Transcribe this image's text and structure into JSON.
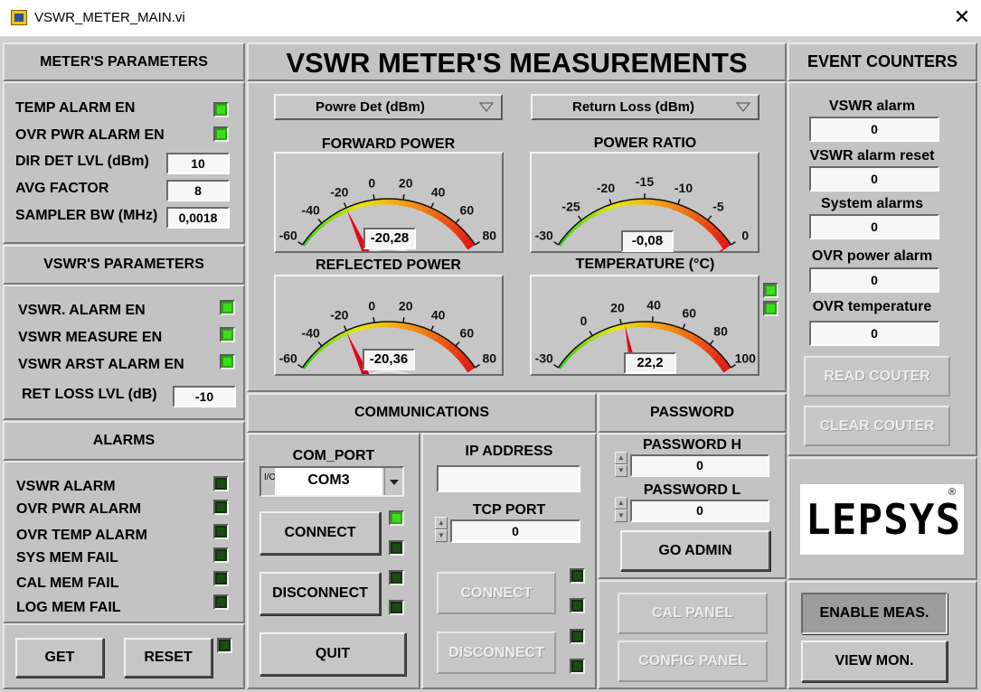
{
  "window": {
    "title": "VSWR_METER_MAIN.vi",
    "close_glyph": "✕",
    "app_icon": "labview-vi-icon"
  },
  "meters_params": {
    "header": "METER'S PARAMETERS",
    "temp_alarm_en": "TEMP ALARM EN",
    "ovr_pwr_alarm_en": "OVR PWR ALARM EN",
    "dir_det_lvl_label": "DIR DET LVL (dBm)",
    "dir_det_lvl_value": "10",
    "avg_factor_label": "AVG FACTOR",
    "avg_factor_value": "8",
    "sampler_bw_label": "SAMPLER BW (MHz)",
    "sampler_bw_value": "0,0018"
  },
  "vswr_params": {
    "header": "VSWR'S  PARAMETERS",
    "vswr_alarm_en": "VSWR. ALARM EN",
    "vswr_measure_en": "VSWR MEASURE EN",
    "vswr_arst_alarm_en": "VSWR ARST ALARM EN",
    "ret_loss_lvl_label": "RET LOSS LVL (dB)",
    "ret_loss_lvl_value": "-10"
  },
  "alarms": {
    "header": "ALARMS",
    "items": [
      "VSWR ALARM",
      "OVR PWR ALARM",
      "OVR TEMP ALARM",
      "SYS MEM FAIL",
      "CAL MEM FAIL",
      "LOG MEM FAIL"
    ],
    "get_label": "GET",
    "reset_label": "RESET"
  },
  "measurements": {
    "header": "VSWR METER'S MEASUREMENTS",
    "left_ring": "Powre Det (dBm)",
    "right_ring": "Return Loss (dBm)",
    "gauges": [
      {
        "title": "FORWARD POWER",
        "value": "-20,28",
        "needle": -20.28,
        "min": -60,
        "max": 80,
        "ticks": [
          "-60",
          "-40",
          "-20",
          "0",
          "20",
          "40",
          "60",
          "80"
        ]
      },
      {
        "title": "POWER RATIO",
        "value": "-0,08",
        "needle": -0.08,
        "min": -30,
        "max": 0,
        "ticks": [
          "-30",
          "-25",
          "-20",
          "-15",
          "-10",
          "-5",
          "0"
        ]
      },
      {
        "title": "REFLECTED POWER",
        "value": "-20,36",
        "needle": -20.36,
        "min": -60,
        "max": 80,
        "ticks": [
          "-60",
          "-40",
          "-20",
          "0",
          "20",
          "40",
          "60",
          "80"
        ]
      },
      {
        "title": "TEMPERATURE (°C)",
        "value": "22,2",
        "needle": 22.2,
        "min": -30,
        "max": 100,
        "ticks": [
          "-30",
          "0",
          "20",
          "40",
          "60",
          "80",
          "100"
        ]
      }
    ]
  },
  "event_counters": {
    "header": "EVENT COUNTERS",
    "items": [
      {
        "label": "VSWR alarm",
        "value": "0"
      },
      {
        "label": "VSWR alarm reset",
        "value": "0"
      },
      {
        "label": "System alarms",
        "value": "0"
      },
      {
        "label": "OVR power alarm",
        "value": "0"
      },
      {
        "label": "OVR temperature",
        "value": "0"
      }
    ],
    "read_label": "READ COUTER",
    "clear_label": "CLEAR COUTER"
  },
  "communications": {
    "header": "COMMUNICATIONS",
    "com_port_label": "COM_PORT",
    "com_port_value": "COM3",
    "io_glyph": "I/O",
    "connect_label": "CONNECT",
    "disconnect_label": "DISCONNECT",
    "quit_label": "QUIT",
    "ip_label": "IP ADDRESS",
    "ip_value": "",
    "tcp_label": "TCP PORT",
    "tcp_value": "0",
    "tcp_connect_label": "CONNECT",
    "tcp_disconnect_label": "DISCONNECT"
  },
  "password": {
    "header": "PASSWORD",
    "h_label": "PASSWORD H",
    "h_value": "0",
    "l_label": "PASSWORD L",
    "l_value": "0",
    "go_admin_label": "GO ADMIN",
    "cal_panel_label": "CAL PANEL",
    "config_panel_label": "CONFIG PANEL"
  },
  "brand": {
    "logo_text": "LEPSYS",
    "registered": "®"
  },
  "actions": {
    "enable_meas_label": "ENABLE MEAS.",
    "view_mon_label": "VIEW MON."
  },
  "colors": {
    "led_on": "#3cdc1e",
    "led_off": "#1d4a16",
    "panel": "#c3c3c3",
    "needle": "#e8001c"
  }
}
